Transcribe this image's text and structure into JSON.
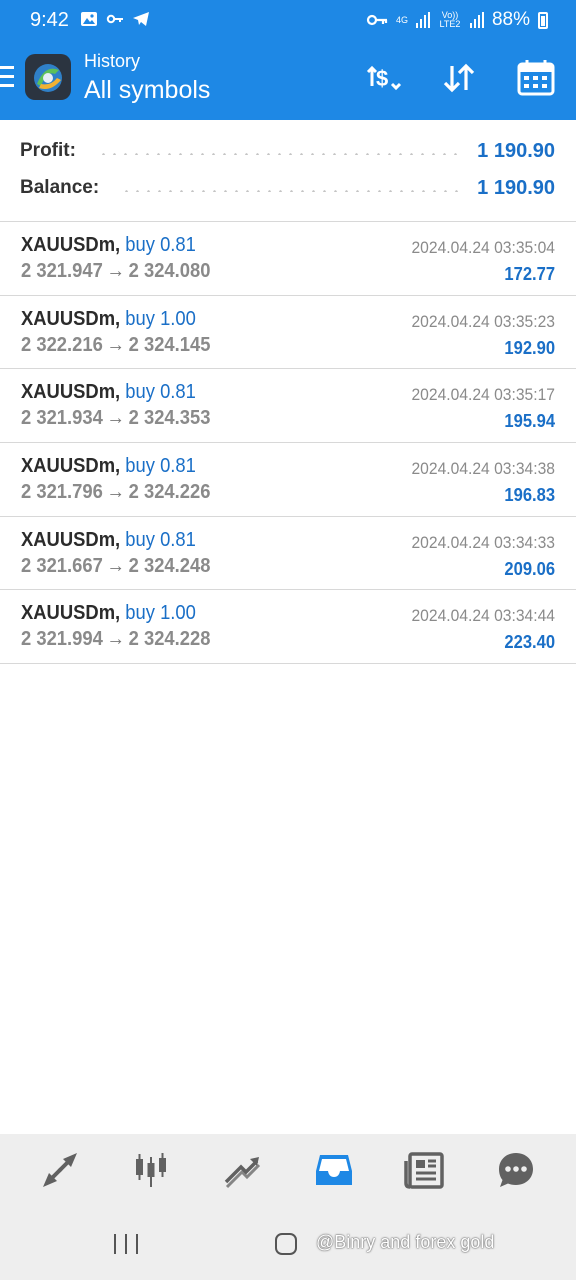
{
  "status_bar": {
    "time": "9:42",
    "battery": "88%",
    "network": "4G",
    "volte": "Vo)) LTE2",
    "icons": [
      "image-icon",
      "key-icon",
      "telegram-icon",
      "vpn-key-icon",
      "signal-icon",
      "battery-icon"
    ]
  },
  "header": {
    "subtitle": "History",
    "title": "All symbols",
    "accent_color": "#1e88e5",
    "actions": [
      "deal-type-icon",
      "sort-icon",
      "calendar-icon"
    ]
  },
  "summary": {
    "profit_label": "Profit:",
    "profit_value": "1 190.90",
    "balance_label": "Balance:",
    "balance_value": "1 190.90"
  },
  "deals": [
    {
      "symbol": "XAUUSDm,",
      "side": "buy 0.81",
      "open_price": "2 321.947",
      "close_price": "2 324.080",
      "datetime": "2024.04.24 03:35:04",
      "profit": "172.77"
    },
    {
      "symbol": "XAUUSDm,",
      "side": "buy 1.00",
      "open_price": "2 322.216",
      "close_price": "2 324.145",
      "datetime": "2024.04.24 03:35:23",
      "profit": "192.90"
    },
    {
      "symbol": "XAUUSDm,",
      "side": "buy 0.81",
      "open_price": "2 321.934",
      "close_price": "2 324.353",
      "datetime": "2024.04.24 03:35:17",
      "profit": "195.94"
    },
    {
      "symbol": "XAUUSDm,",
      "side": "buy 0.81",
      "open_price": "2 321.796",
      "close_price": "2 324.226",
      "datetime": "2024.04.24 03:34:38",
      "profit": "196.83"
    },
    {
      "symbol": "XAUUSDm,",
      "side": "buy 0.81",
      "open_price": "2 321.667",
      "close_price": "2 324.248",
      "datetime": "2024.04.24 03:34:33",
      "profit": "209.06"
    },
    {
      "symbol": "XAUUSDm,",
      "side": "buy 1.00",
      "open_price": "2 321.994",
      "close_price": "2 324.228",
      "datetime": "2024.04.24 03:34:44",
      "profit": "223.40"
    }
  ],
  "price_arrow": "→",
  "bottom_nav": {
    "items": [
      "quotes-icon",
      "chart-icon",
      "trade-icon",
      "history-icon",
      "news-icon",
      "messages-icon"
    ],
    "active": "history-icon",
    "active_color": "#1e88e5"
  },
  "watermark": "@Binry and forex gold"
}
